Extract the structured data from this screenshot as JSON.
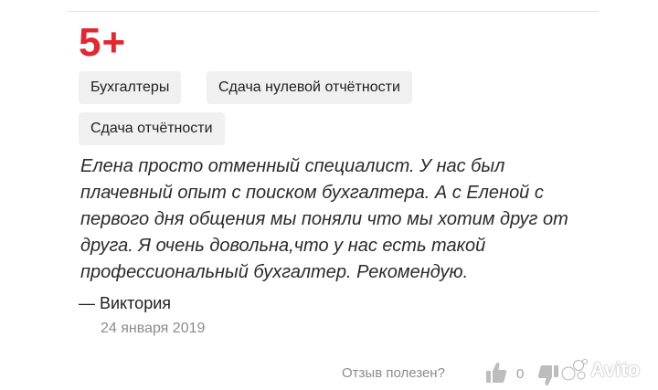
{
  "review": {
    "rating": "5+",
    "tags": [
      {
        "label": "Бухгалтеры"
      },
      {
        "label": "Сдача нулевой отчётности"
      },
      {
        "label": "Сдача отчётности"
      }
    ],
    "text": "Елена просто отменный специалист. У нас был плачевный опыт с поиском бухгалтера. А с Еленой с первого дня общения мы поняли что мы хотим друг от друга. Я очень довольна,что у нас есть такой профессиональный бухгалтер. Рекомендую.",
    "author": "— Виктория",
    "date": "24 января 2019"
  },
  "feedback": {
    "helpful_label": "Отзыв полезен?",
    "up_count": "0",
    "up_icon": "thumbs-up-icon",
    "down_icon": "thumbs-down-icon"
  },
  "watermark": {
    "text": "Avito"
  },
  "colors": {
    "rating": "#e4272f",
    "tag_bg": "#f0f0f0",
    "muted": "#8c8c8c"
  }
}
